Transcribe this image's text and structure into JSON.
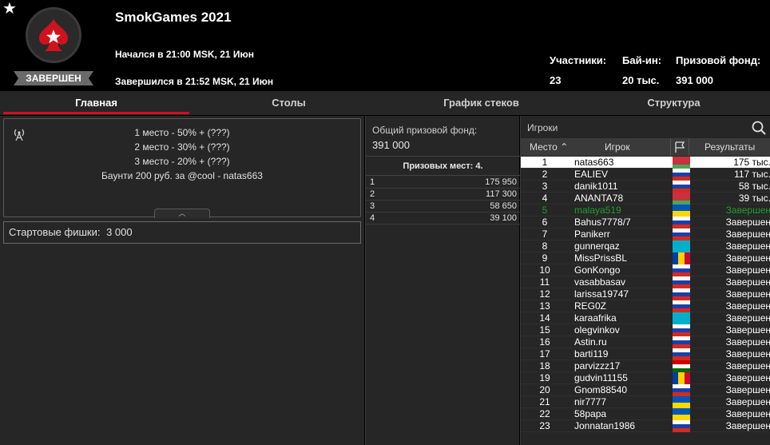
{
  "header": {
    "title": "SmokGames 2021",
    "status": "ЗАВЕРШЕН",
    "started": "Начался в 21:00 MSK, 21 Июн",
    "ended": "Завершился в 21:52 MSK, 21 Июн",
    "participants_label": "Участники:",
    "participants_value": "23",
    "buyin_label": "Бай-ин:",
    "buyin_value": "20 тыс.",
    "prizepool_label": "Призовой фонд:",
    "prizepool_value": "391 000"
  },
  "tabs": [
    {
      "label": "Главная",
      "active": true
    },
    {
      "label": "Столы",
      "active": false
    },
    {
      "label": "График стеков",
      "active": false
    },
    {
      "label": "Структура",
      "active": false
    }
  ],
  "info": {
    "lines": [
      "1 место - 50% + (???)",
      "2 место - 30% + (???)",
      "3 место - 20% + (???)",
      "Баунти 200 руб. за @cool - natas663"
    ],
    "starting_chips_label": "Стартовые фишки:",
    "starting_chips_value": "3 000"
  },
  "prize": {
    "pool_label": "Общий призовой фонд:",
    "pool_value": "391 000",
    "places_header": "Призовых мест: 4.",
    "payouts": [
      {
        "place": "1",
        "amount": "175 950"
      },
      {
        "place": "2",
        "amount": "117 300"
      },
      {
        "place": "3",
        "amount": "58 650"
      },
      {
        "place": "4",
        "amount": "39 100"
      }
    ]
  },
  "players": {
    "label": "Игроки",
    "col_place": "Место",
    "col_player": "Игрок",
    "col_results": "Результаты",
    "rows": [
      {
        "place": "1",
        "name": "natas663",
        "flag": "by",
        "result": "175 тыс."
      },
      {
        "place": "2",
        "name": "EALIEV",
        "flag": "ru",
        "result": "117 тыс."
      },
      {
        "place": "3",
        "name": "danik1011",
        "flag": "ru",
        "result": "58 тыс."
      },
      {
        "place": "4",
        "name": "ANANTA78",
        "flag": "by",
        "result": "39 тыс."
      },
      {
        "place": "5",
        "name": "malaya519",
        "flag": "ua",
        "result": "Завершен"
      },
      {
        "place": "6",
        "name": "Bahus7778/7",
        "flag": "ru",
        "result": "Завершен"
      },
      {
        "place": "7",
        "name": "Panikerr",
        "flag": "ru",
        "result": "Завершен"
      },
      {
        "place": "8",
        "name": "gunnerqaz",
        "flag": "kz",
        "result": "Завершен"
      },
      {
        "place": "9",
        "name": "MissPrissBL",
        "flag": "md",
        "result": "Завершен"
      },
      {
        "place": "10",
        "name": "GonKongo",
        "flag": "ru",
        "result": "Завершен"
      },
      {
        "place": "11",
        "name": "vasabbasav",
        "flag": "ru",
        "result": "Завершен"
      },
      {
        "place": "12",
        "name": "larissa19747",
        "flag": "ru",
        "result": "Завершен"
      },
      {
        "place": "13",
        "name": "REG0Z",
        "flag": "ru",
        "result": "Завершен"
      },
      {
        "place": "14",
        "name": "karaafrika",
        "flag": "kz",
        "result": "Завершен"
      },
      {
        "place": "15",
        "name": "olegvinkov",
        "flag": "ru",
        "result": "Завершен"
      },
      {
        "place": "16",
        "name": "Astin.ru",
        "flag": "ru",
        "result": "Завершен"
      },
      {
        "place": "17",
        "name": "barti119",
        "flag": "ru",
        "result": "Завершен"
      },
      {
        "place": "18",
        "name": "parvizzz17",
        "flag": "tj",
        "result": "Завершен"
      },
      {
        "place": "19",
        "name": "gudvin11155",
        "flag": "md",
        "result": "Завершен"
      },
      {
        "place": "20",
        "name": "Gnom88540",
        "flag": "ru",
        "result": "Завершен"
      },
      {
        "place": "21",
        "name": "nir7777",
        "flag": "ua",
        "result": "Завершен"
      },
      {
        "place": "22",
        "name": "58papa",
        "flag": "ua",
        "result": "Завершен"
      },
      {
        "place": "23",
        "name": "Jonnatan1986",
        "flag": "ru",
        "result": "Завершен"
      }
    ]
  },
  "colors": {
    "accent": "#d0121f",
    "winner_row_bg": "#ffffff",
    "eliminated_green": "#1f9f2f"
  },
  "icons": {
    "star": "star-icon",
    "antenna": "antenna-icon",
    "search": "search-icon",
    "flag_header": "flag-icon",
    "sort": "chevron-up-icon"
  }
}
